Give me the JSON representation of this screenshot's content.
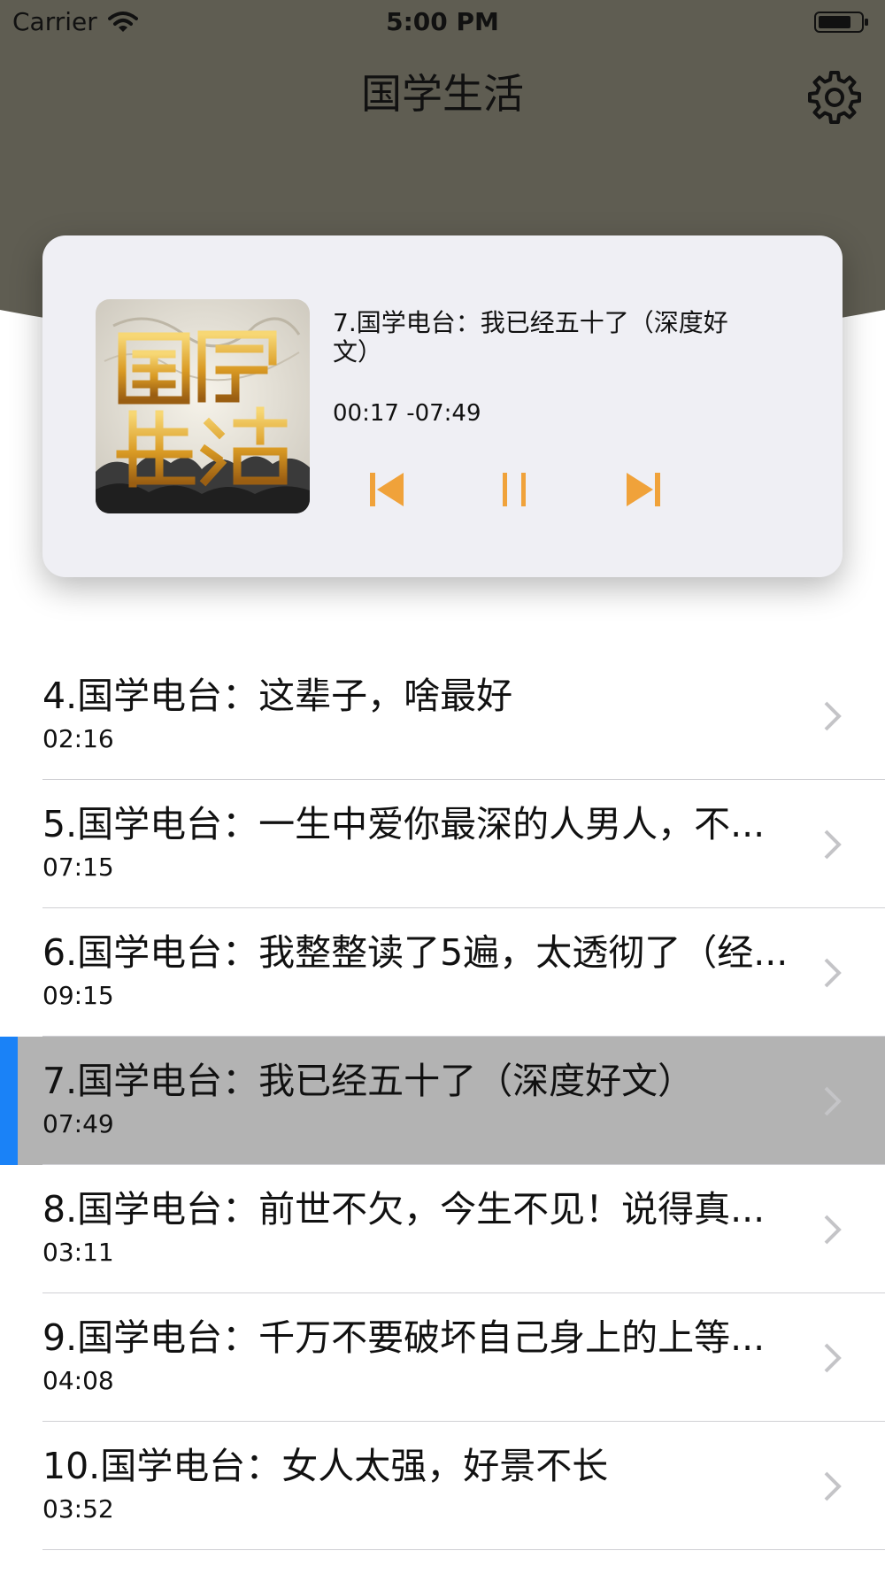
{
  "colors": {
    "header_bg": "#5f5d52",
    "card_bg": "#efeff4",
    "accent_orange": "#f0a23a",
    "active_row_bg": "#b3b3b3",
    "active_indicator": "#1a82f7"
  },
  "status_bar": {
    "carrier": "Carrier",
    "time": "5:00 PM"
  },
  "nav": {
    "title": "国学生活",
    "settings_icon": "gear-icon"
  },
  "player": {
    "album_icon": "album-art",
    "track_title": "7.国学电台：我已经五十了（深度好文）",
    "time_display": "00:17 -07:49",
    "controls": [
      "skip-previous-icon",
      "pause-icon",
      "skip-next-icon"
    ]
  },
  "tracks": [
    {
      "title": "4.国学电台：这辈子，啥最好",
      "duration": "02:16",
      "active": false
    },
    {
      "title": "5.国学电台：一生中爱你最深的人男人，不...",
      "duration": "07:15",
      "active": false
    },
    {
      "title": "6.国学电台：我整整读了5遍，太透彻了（经...",
      "duration": "09:15",
      "active": false
    },
    {
      "title": "7.国学电台：我已经五十了（深度好文）",
      "duration": "07:49",
      "active": true
    },
    {
      "title": "8.国学电台：前世不欠，今生不见！说得真...",
      "duration": "03:11",
      "active": false
    },
    {
      "title": "9.国学电台：千万不要破坏自己身上的上等...",
      "duration": "04:08",
      "active": false
    },
    {
      "title": "10.国学电台：女人太强，好景不长",
      "duration": "03:52",
      "active": false
    }
  ]
}
